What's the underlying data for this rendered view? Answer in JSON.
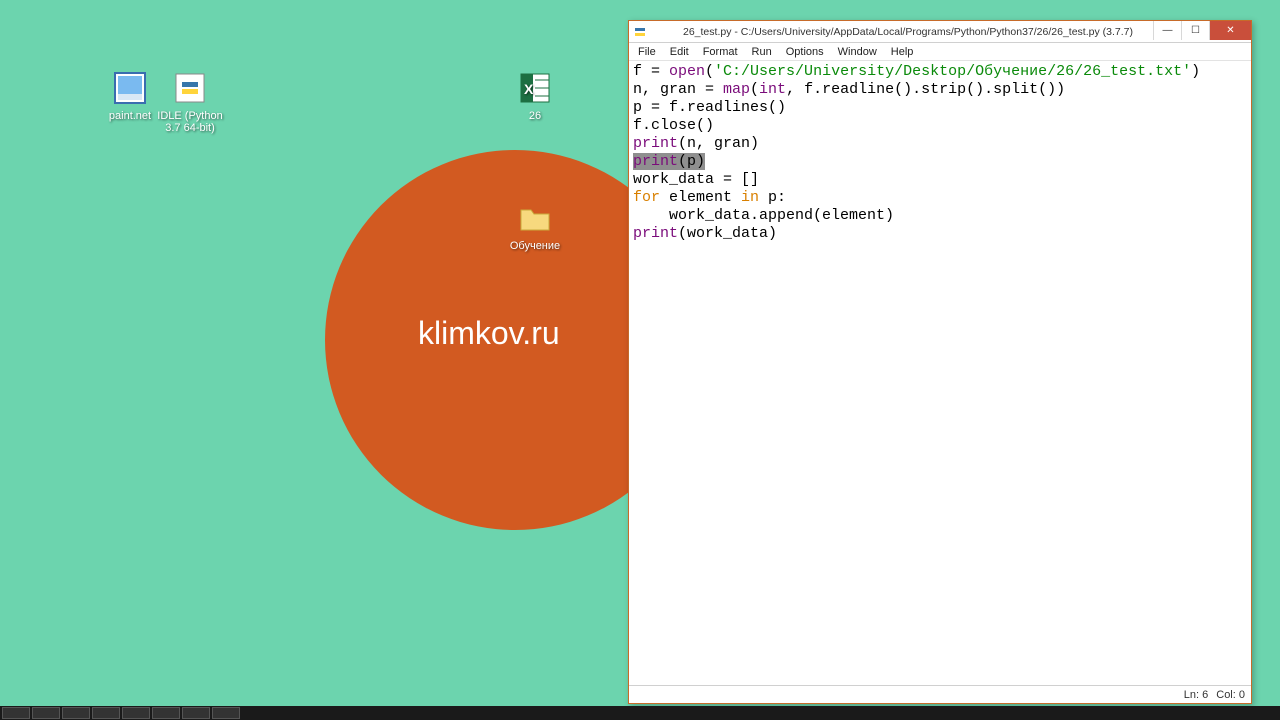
{
  "wallpaper": {
    "text": "klimkov.ru"
  },
  "desktop_icons": {
    "paintnet": "paint.net",
    "idle": "IDLE (Python 3.7 64-bit)",
    "excel": "26",
    "folder": "Обучение"
  },
  "window": {
    "title": "26_test.py - C:/Users/University/AppData/Local/Programs/Python/Python37/26/26_test.py (3.7.7)",
    "menu": {
      "file": "File",
      "edit": "Edit",
      "format": "Format",
      "run": "Run",
      "options": "Options",
      "window": "Window",
      "help": "Help"
    },
    "code": {
      "l1a": "f = ",
      "l1b": "open",
      "l1c": "(",
      "l1d": "'C:/Users/University/Desktop/Обучение/26/26_test.txt'",
      "l1e": ")",
      "l2a": "n, gran = ",
      "l2b": "map",
      "l2c": "(",
      "l2d": "int",
      "l2e": ", f.readline().strip().split())",
      "l3": "p = f.readlines()",
      "l4": "f.close()",
      "l5a": "print",
      "l5b": "(n, gran)",
      "l6a": "print",
      "l6b": "(p)",
      "l7": "work_data = []",
      "l8a": "for",
      "l8b": " element ",
      "l8c": "in",
      "l8d": " p:",
      "l9": "    work_data.append(element)",
      "l10a": "print",
      "l10b": "(work_data)"
    },
    "status": {
      "ln": "Ln: 6",
      "col": "Col: 0"
    }
  }
}
